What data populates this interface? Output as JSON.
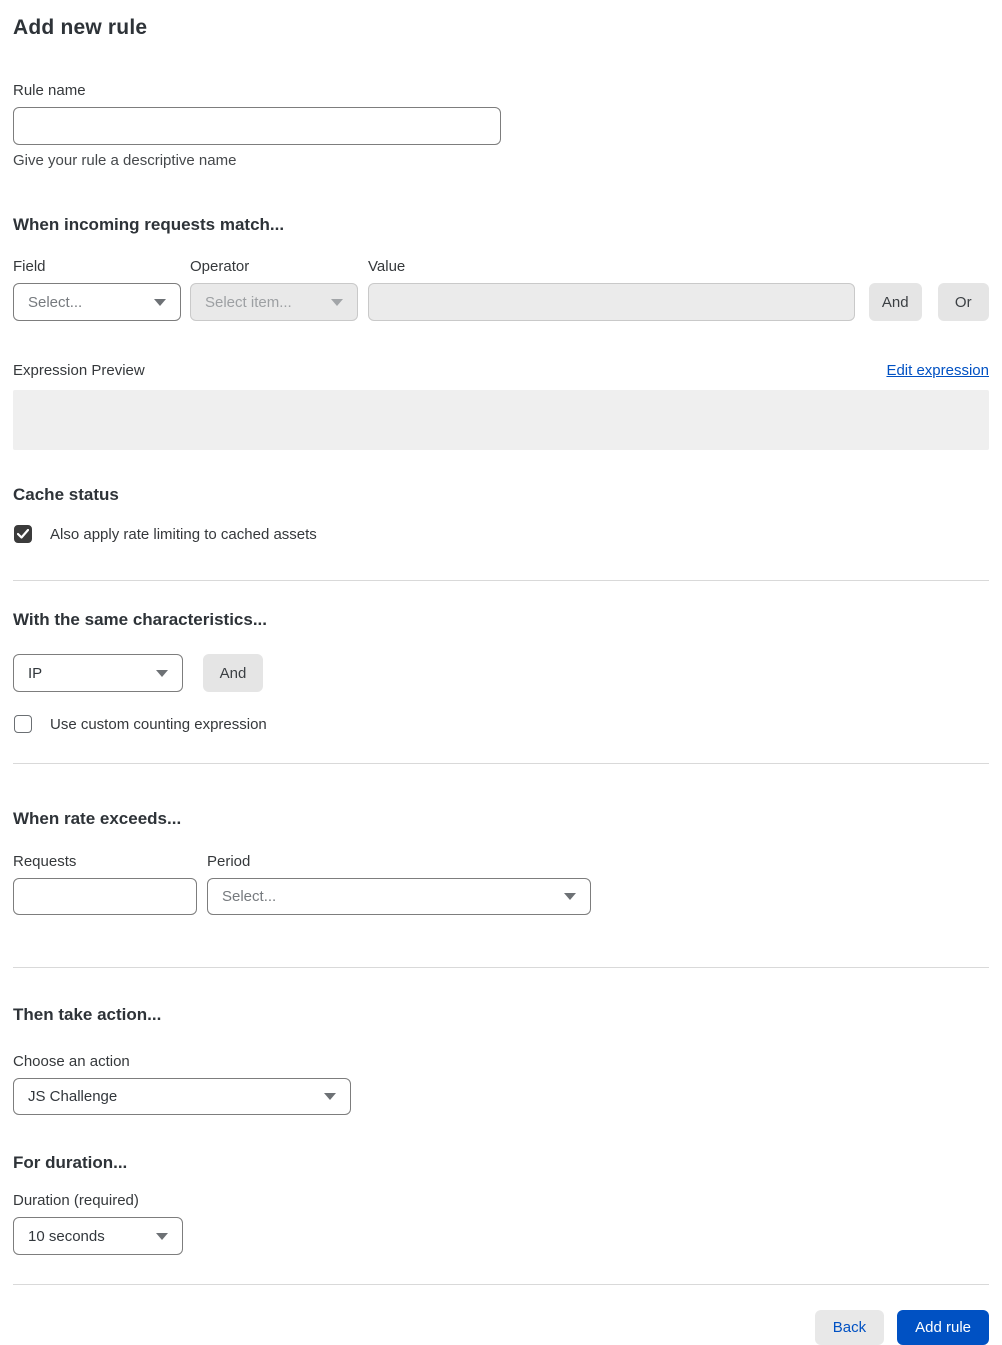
{
  "page": {
    "title": "Add new rule"
  },
  "rule_name": {
    "label": "Rule name",
    "value": "",
    "help": "Give your rule a descriptive name"
  },
  "match_section": {
    "heading": "When incoming requests match...",
    "field": {
      "label": "Field",
      "selected": "Select..."
    },
    "operator": {
      "label": "Operator",
      "selected": "Select item..."
    },
    "value": {
      "label": "Value",
      "value": ""
    },
    "and_button": "And",
    "or_button": "Or"
  },
  "expression": {
    "label": "Expression Preview",
    "edit_link": "Edit expression",
    "value": ""
  },
  "cache_status": {
    "heading": "Cache status",
    "checkbox_label": "Also apply rate limiting to cached assets",
    "checked": true
  },
  "characteristics": {
    "heading": "With the same characteristics...",
    "selected": "IP",
    "and_button": "And",
    "checkbox_label": "Use custom counting expression",
    "checked": false
  },
  "rate": {
    "heading": "When rate exceeds...",
    "requests": {
      "label": "Requests",
      "value": ""
    },
    "period": {
      "label": "Period",
      "selected": "Select..."
    }
  },
  "action": {
    "heading": "Then take action...",
    "label": "Choose an action",
    "selected": "JS Challenge"
  },
  "duration": {
    "heading": "For duration...",
    "label": "Duration (required)",
    "selected": "10 seconds"
  },
  "footer": {
    "back_button": "Back",
    "add_rule_button": "Add rule"
  },
  "colors": {
    "accent_blue": "#0051c3",
    "checkbox_checked": "#3b3b3b",
    "disabled_bg": "#e9e9e9",
    "divider": "#d9d9d9"
  }
}
